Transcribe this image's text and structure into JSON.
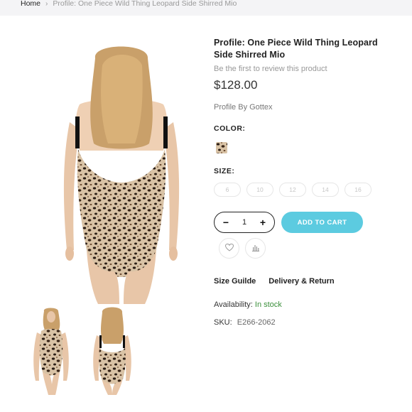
{
  "breadcrumb": {
    "home": "Home",
    "separator": "›",
    "current": "Profile: One Piece Wild Thing Leopard Side Shirred Mio"
  },
  "product": {
    "title": "Profile: One Piece Wild Thing Leopard Side Shirred Mio",
    "review_link": "Be the first to review this product",
    "price": "$128.00",
    "brand": "Profile By Gottex",
    "color_label": "COLOR:",
    "size_label": "SIZE:",
    "sizes": [
      "6",
      "10",
      "12",
      "14",
      "16"
    ],
    "quantity": "1",
    "qty_minus": "−",
    "qty_plus": "+",
    "add_to_cart": "ADD TO CART",
    "size_guide": "Size Guilde",
    "delivery_return": "Delivery & Return",
    "availability_label": "Availability:",
    "availability_value": "In stock",
    "sku_label": "SKU:",
    "sku_value": "E266-2062"
  },
  "icons": {
    "wishlist": "heart-icon",
    "compare": "bar-chart-icon"
  },
  "colors": {
    "accent": "#5ccbe0",
    "in_stock": "#3b8f3b"
  }
}
